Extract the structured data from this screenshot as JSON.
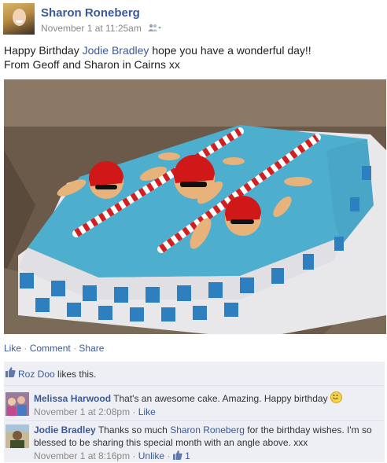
{
  "post": {
    "author": "Sharon Roneberg",
    "timestamp": "November 1 at 11:25am",
    "audience_icon": "friends-icon",
    "message_line1_pre": "Happy Birthday ",
    "message_tag": "Jodie Bradley",
    "message_line1_post": " hope you have a wonderful day!!",
    "message_line2": "From Geoff and Sharon in Cairns xx",
    "photo_icon": "birthday-cake-swimming-pool-photo"
  },
  "actions": {
    "like": "Like",
    "comment": "Comment",
    "share": "Share",
    "separator": "·"
  },
  "likes": {
    "name": "Roz Doo",
    "text": " likes this."
  },
  "comments": [
    {
      "author": "Melissa Harwood",
      "text": " That's an awesome cake. Amazing. Happy birthday ",
      "emoji": "smiley-icon",
      "time": "November 1 at 2:08pm",
      "action": "Like"
    },
    {
      "author": "Jodie Bradley",
      "text_pre": " Thanks so much ",
      "tag": "Sharon Roneberg",
      "text_post": " for the birthday wishes. I'm so blessed to be sharing this special month with an angle above. xxx",
      "time": "November 1 at 8:16pm",
      "action": "Unlike",
      "like_count": "1"
    }
  ],
  "colors": {
    "link": "#3b5998",
    "feedback_bg": "#edeff4",
    "pool": "#4eaecd"
  }
}
